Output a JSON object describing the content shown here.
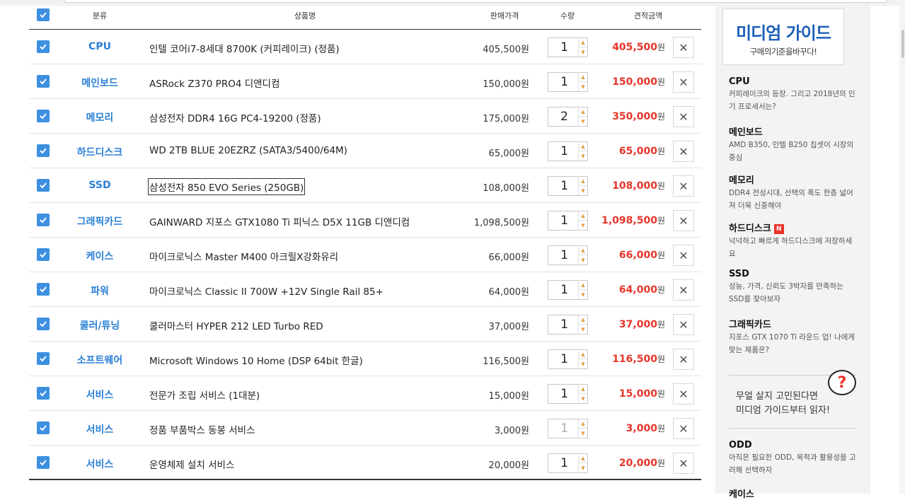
{
  "header": {
    "category": "분류",
    "product": "상품명",
    "price": "판매가격",
    "qty": "수량",
    "amount": "견적금액"
  },
  "rows": [
    {
      "category": "CPU",
      "name": "인텔 코어i7-8세대 8700K (커피레이크) (정품)",
      "price": "405,500원",
      "qty": "1",
      "amount": "405,500",
      "won": "원"
    },
    {
      "category": "메인보드",
      "name": "ASRock Z370 PRO4 디앤디컴",
      "price": "150,000원",
      "qty": "1",
      "amount": "150,000",
      "won": "원"
    },
    {
      "category": "메모리",
      "name": "삼성전자 DDR4 16G PC4-19200 (정품)",
      "price": "175,000원",
      "qty": "2",
      "amount": "350,000",
      "won": "원"
    },
    {
      "category": "하드디스크",
      "name": "WD 2TB BLUE 20EZRZ (SATA3/5400/64M)",
      "price": "65,000원",
      "qty": "1",
      "amount": "65,000",
      "won": "원"
    },
    {
      "category": "SSD",
      "name": "삼성전자 850 EVO Series (250GB)",
      "price": "108,000원",
      "qty": "1",
      "amount": "108,000",
      "won": "원"
    },
    {
      "category": "그래픽카드",
      "name": "GAINWARD 지포스 GTX1080 Ti 피닉스 D5X 11GB 디앤디컴",
      "price": "1,098,500원",
      "qty": "1",
      "amount": "1,098,500",
      "won": "원"
    },
    {
      "category": "케이스",
      "name": "마이크로닉스 Master M400 아크릴X강화유리",
      "price": "66,000원",
      "qty": "1",
      "amount": "66,000",
      "won": "원"
    },
    {
      "category": "파워",
      "name": "마이크로닉스 Classic II 700W +12V Single Rail 85+",
      "price": "64,000원",
      "qty": "1",
      "amount": "64,000",
      "won": "원"
    },
    {
      "category": "쿨러/튜닝",
      "name": "쿨러마스터 HYPER 212 LED Turbo RED",
      "price": "37,000원",
      "qty": "1",
      "amount": "37,000",
      "won": "원"
    },
    {
      "category": "소프트웨어",
      "name": "Microsoft Windows 10 Home (DSP 64bit 한글)",
      "price": "116,500원",
      "qty": "1",
      "amount": "116,500",
      "won": "원"
    },
    {
      "category": "서비스",
      "name": "전문가 조립 서비스 (1대분)",
      "price": "15,000원",
      "qty": "1",
      "amount": "15,000",
      "won": "원"
    },
    {
      "category": "서비스",
      "name": "정품 부품박스 동봉 서비스",
      "price": "3,000원",
      "qty": "1",
      "amount": "3,000",
      "won": "원"
    },
    {
      "category": "서비스",
      "name": "운영체제 설치 서비스",
      "price": "20,000원",
      "qty": "1",
      "amount": "20,000",
      "won": "원"
    }
  ],
  "sidebar": {
    "hero_title": "미디엄 가이드",
    "hero_sub": "구매의기준을바꾸다!",
    "guides": [
      {
        "title": "CPU",
        "desc": "커피레이크의 등장. 그리고 2018년의 인기 프로세서는?"
      },
      {
        "title": "메인보드",
        "desc": "AMD B350, 인텔 B250 칩셋이 시장의 중심"
      },
      {
        "title": "메모리",
        "desc": "DDR4 전성시대, 선택의 폭도 한층 넓어져 더욱 신중해야"
      },
      {
        "title": "하드디스크",
        "badge": "N",
        "desc": "넉넉하고 빠르게 하드디스크에 저장하세요"
      },
      {
        "title": "SSD",
        "desc": "성능, 가격, 신뢰도 3박자를 만족하는 SSD를 찾아보자"
      },
      {
        "title": "그래픽카드",
        "desc": "지포스 GTX 1070 Ti 라운드 업! 나에게 맞는 제품은?"
      }
    ],
    "promo_line1": "무얼 살지 고민된다면",
    "promo_line2": "미디엄 가이드부터 읽자!",
    "promo_icon": "?",
    "guide_odd_title": "ODD",
    "guide_odd_desc": "아직은 필요한 ODD, 목적과 활용성을 고려해 선택하자",
    "guide_case_title": "케이스"
  },
  "colors": {
    "accent": "#3d8fe0",
    "amount": "#e8352a",
    "brand": "#1c5fb8"
  }
}
